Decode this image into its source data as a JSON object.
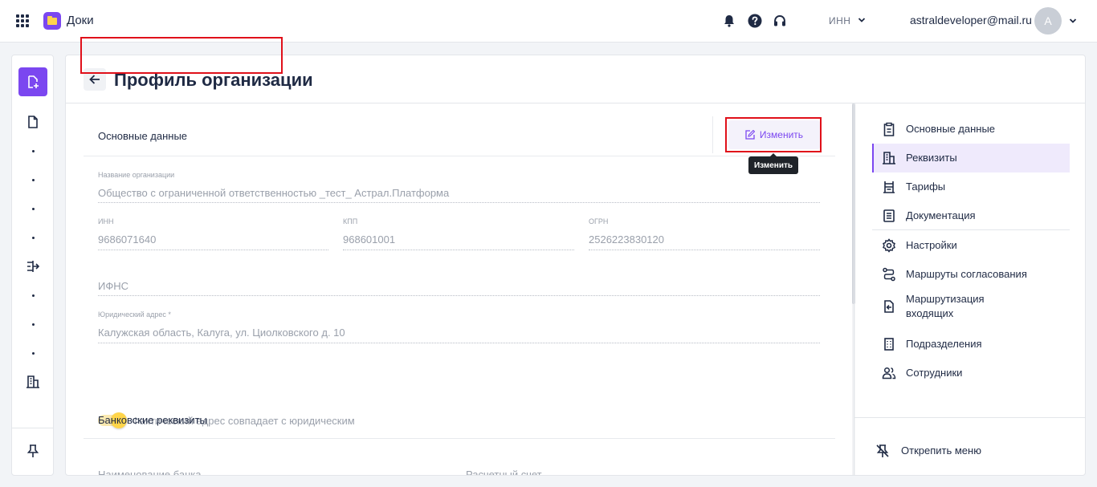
{
  "header": {
    "app_title": "Доки",
    "inn_select": "ИНН",
    "user_email": "astraldeveloper@mail.ru",
    "avatar_letter": "A"
  },
  "page": {
    "title": "Профиль организации"
  },
  "main_section": {
    "title": "Основные данные",
    "edit_label": "Изменить",
    "tooltip": "Изменить"
  },
  "fields": {
    "org_name": {
      "label": "Название организации",
      "value": "Общество с ограниченной ответственностью _тест_ Астрал.Платформа"
    },
    "inn": {
      "label": "ИНН",
      "value": "9686071640"
    },
    "kpp": {
      "label": "КПП",
      "value": "968601001"
    },
    "ogrn": {
      "label": "ОГРН",
      "value": "2526223830120"
    },
    "ifns": {
      "label": "ИФНС",
      "value": ""
    },
    "legal_address": {
      "label": "Юридический адрес *",
      "value": "Калужская область, Калуга, ул. Циолковского д. 10"
    }
  },
  "toggle": {
    "label": "Фактический адрес совпадает с юридическим",
    "checked": true
  },
  "bank_section": {
    "title": "Банковские реквизиты",
    "bank_name_label": "Наименование банка",
    "account_label": "Расчетный счет"
  },
  "side_nav": {
    "items": [
      {
        "label": "Основные данные",
        "icon": "clipboard-icon"
      },
      {
        "label": "Реквизиты",
        "icon": "building-icon",
        "active": true
      },
      {
        "label": "Тарифы",
        "icon": "tariff-icon"
      },
      {
        "label": "Документация",
        "icon": "document-list-icon"
      },
      {
        "label": "Настройки",
        "icon": "gear-icon"
      },
      {
        "label": "Маршруты согласования",
        "icon": "route-icon"
      },
      {
        "label": "Маршрутизация входящих",
        "icon": "incoming-routing-icon"
      },
      {
        "label": "Подразделения",
        "icon": "office-building-icon"
      },
      {
        "label": "Сотрудники",
        "icon": "people-icon"
      }
    ],
    "unpin_label": "Открепить меню"
  },
  "colors": {
    "accent": "#7b47f0",
    "highlight": "#e0101a",
    "toggle_on": "#ffd54a"
  }
}
